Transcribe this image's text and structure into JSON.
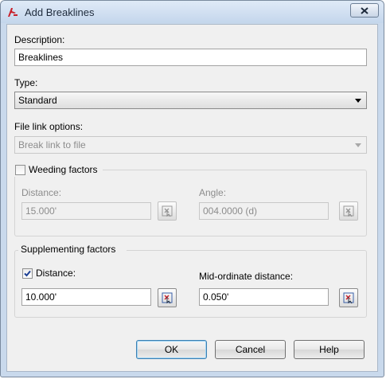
{
  "window": {
    "title": "Add Breaklines"
  },
  "description": {
    "label": "Description:",
    "value": "Breaklines"
  },
  "type": {
    "label": "Type:",
    "selected": "Standard"
  },
  "file_link": {
    "label": "File link options:",
    "selected": "Break link to file"
  },
  "weeding": {
    "label": "Weeding factors",
    "checked": false,
    "distance_label": "Distance:",
    "distance_value": "15.000'",
    "angle_label": "Angle:",
    "angle_value": "004.0000 (d)"
  },
  "supplementing": {
    "label": "Supplementing factors",
    "distance_label": "Distance:",
    "distance_checked": true,
    "distance_value": "10.000'",
    "midordinate_label": "Mid-ordinate distance:",
    "midordinate_value": "0.050'"
  },
  "buttons": {
    "ok": "OK",
    "cancel": "Cancel",
    "help": "Help"
  }
}
